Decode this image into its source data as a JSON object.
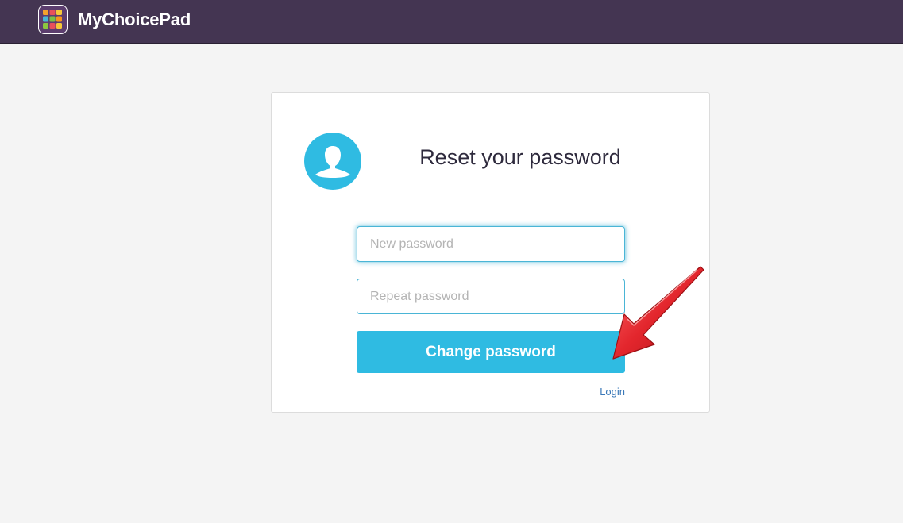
{
  "header": {
    "brand": "MyChoicePad",
    "logo_colors": [
      "#f4a22d",
      "#e8505b",
      "#f6c838",
      "#47b5d7",
      "#7ac143",
      "#f7941d",
      "#8cc63f",
      "#e8505b",
      "#f6c838"
    ]
  },
  "card": {
    "title": "Reset your password",
    "new_password_placeholder": "New password",
    "repeat_password_placeholder": "Repeat password",
    "submit_label": "Change password",
    "login_link": "Login"
  },
  "colors": {
    "accent": "#2fbbe2",
    "header_bg": "#443552",
    "link": "#3a78b8",
    "annotation_arrow": "#e3262d"
  }
}
